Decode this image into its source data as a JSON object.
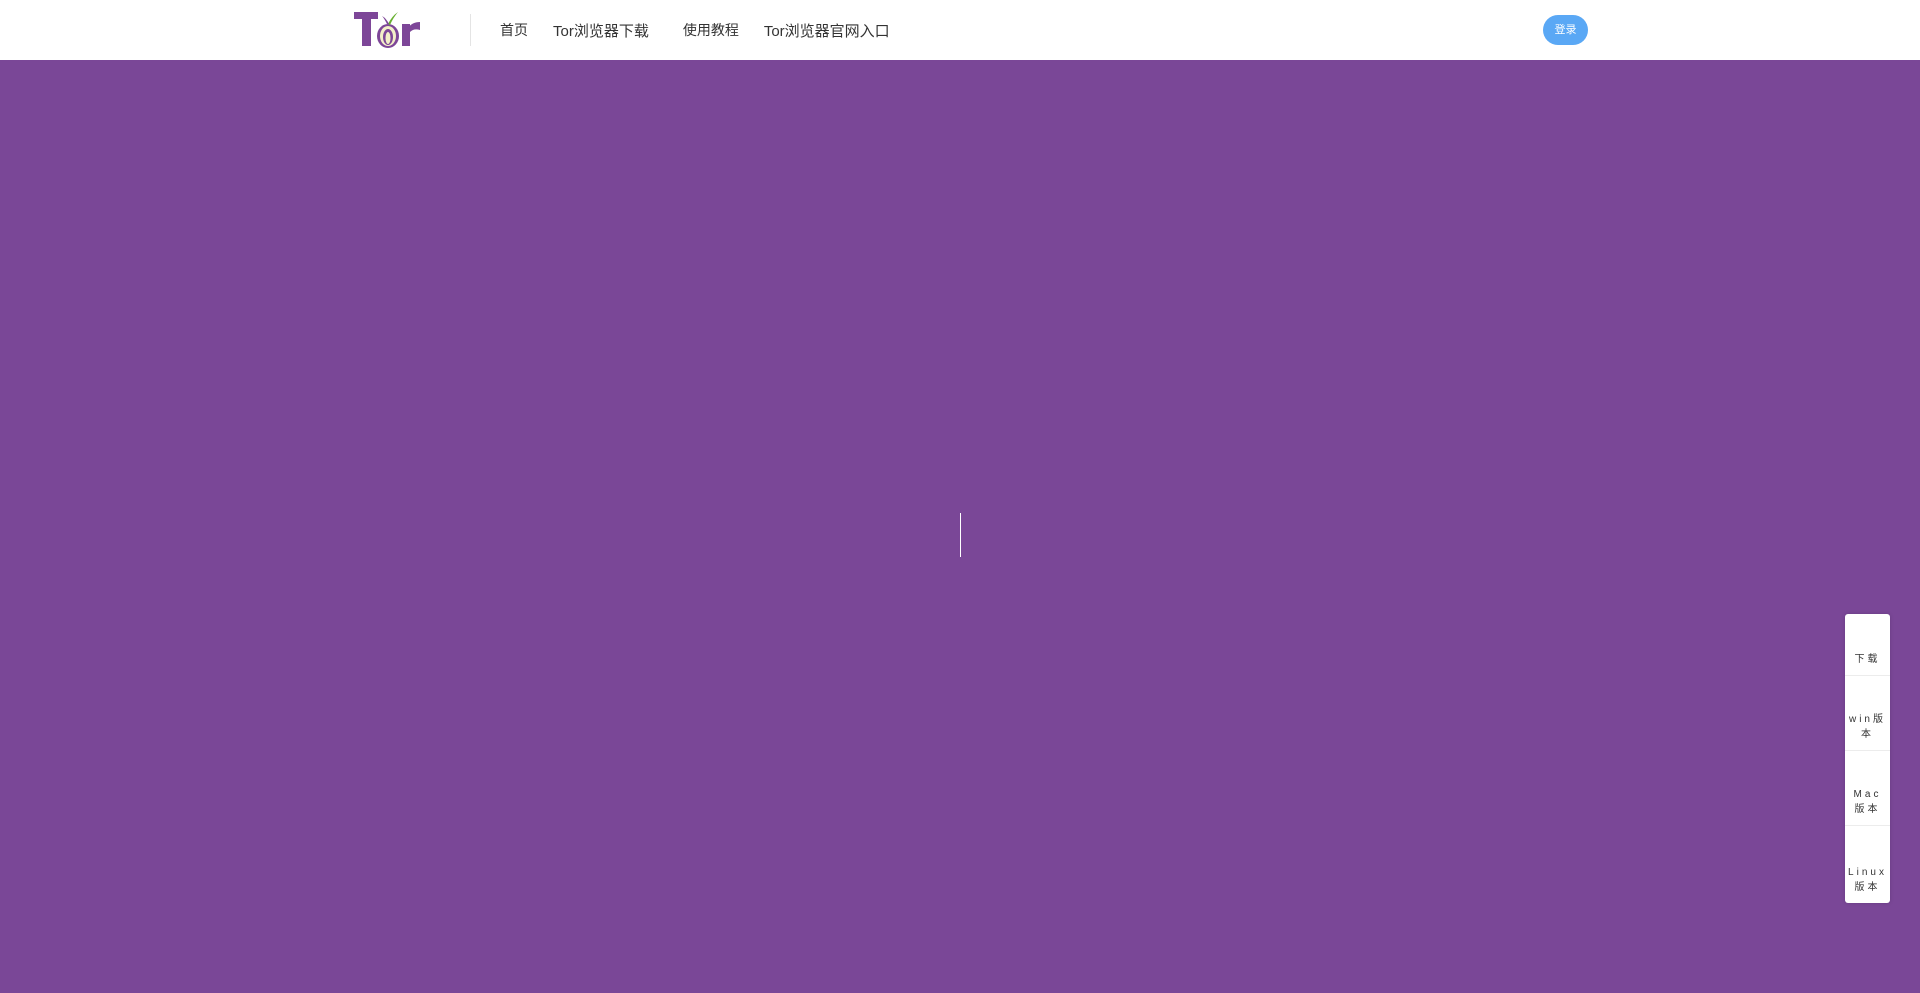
{
  "header": {
    "logo_alt": "Tor",
    "nav": [
      {
        "label": "首页"
      },
      {
        "label": "Tor浏览器下载"
      },
      {
        "label": "使用教程"
      },
      {
        "label": "Tor浏览器官网入口"
      }
    ],
    "login_label": "登录"
  },
  "side_panel": {
    "items": [
      {
        "line1": "下载",
        "line2": ""
      },
      {
        "line1": "win版",
        "line2": "本"
      },
      {
        "line1": "Mac",
        "line2": "版本"
      },
      {
        "line1": "Linux",
        "line2": "版本"
      }
    ]
  },
  "colors": {
    "hero_bg": "#7a4797",
    "accent_blue": "#5aa8f5",
    "logo_purple": "#7d4698"
  }
}
